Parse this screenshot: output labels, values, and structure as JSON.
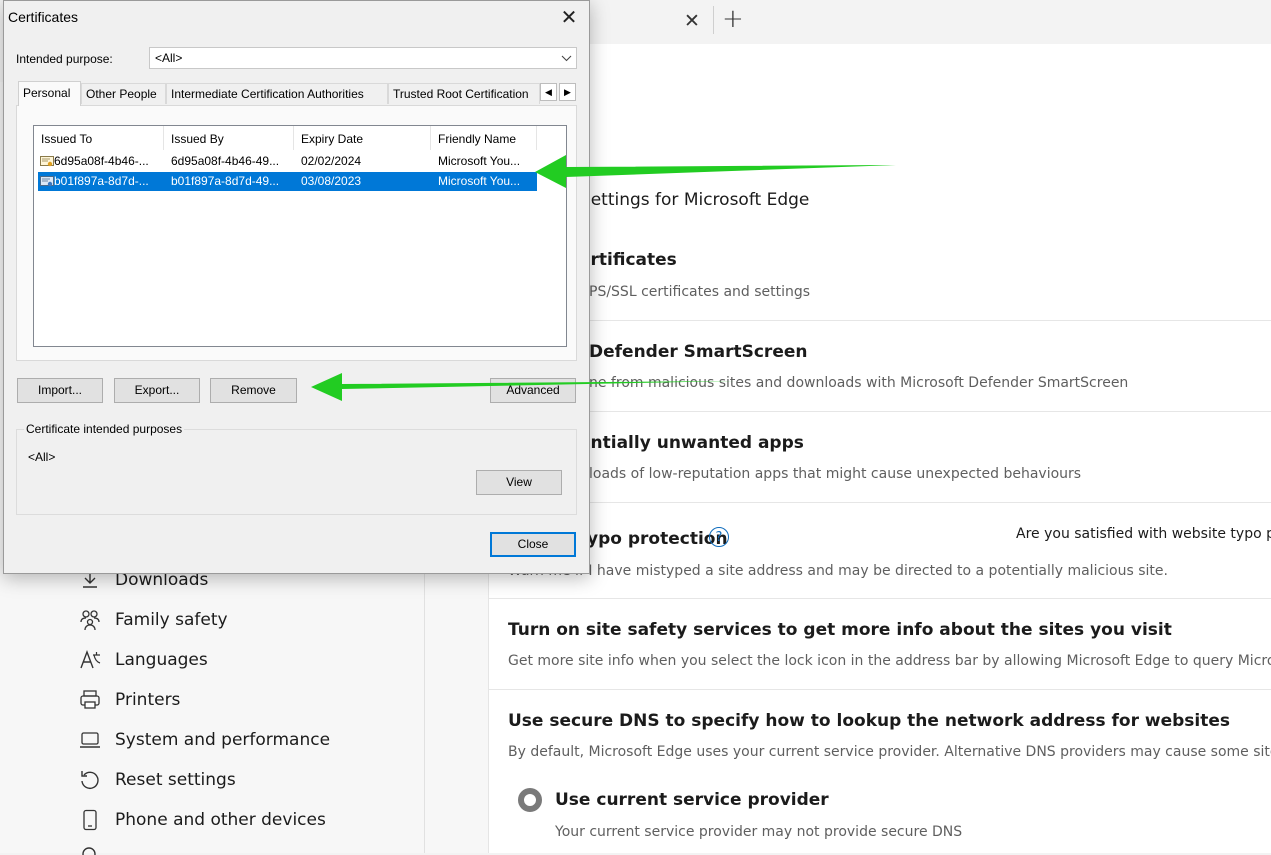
{
  "browser": {
    "tab_close_symbol": "✕",
    "new_tab_symbol": "+"
  },
  "sidebar": {
    "items": [
      {
        "label": "Downloads",
        "icon": "download-icon"
      },
      {
        "label": "Family safety",
        "icon": "family-icon"
      },
      {
        "label": "Languages",
        "icon": "languages-icon"
      },
      {
        "label": "Printers",
        "icon": "printer-icon"
      },
      {
        "label": "System and performance",
        "icon": "laptop-icon"
      },
      {
        "label": "Reset settings",
        "icon": "reset-icon"
      },
      {
        "label": "Phone and other devices",
        "icon": "phone-icon"
      }
    ]
  },
  "settings": {
    "section_title": "rity settings for Microsoft Edge",
    "rows": [
      {
        "title": "ertificates",
        "desc": "PS/SSL certificates and settings"
      },
      {
        "title": "Defender SmartScreen",
        "desc_a": "ne from malicious si",
        "desc_b": "tes and downloads with Microsoft Defender SmartScreen"
      },
      {
        "title": "entially unwanted apps",
        "desc": "loads of low-reputation apps that might cause unexpected behaviours"
      },
      {
        "title": "ypo protection",
        "desc": "Warn me if I have mistyped a site address and may be directed to a potentially malicious site.",
        "help": "?",
        "feedback": "Are you satisfied with website typo pro"
      },
      {
        "title": "Turn on site safety services to get more info about the sites you visit",
        "desc": "Get more site info when you select the lock icon in the address bar by allowing Microsoft Edge to query Microsoft B"
      },
      {
        "title": "Use secure DNS to specify how to lookup the network address for websites",
        "desc": "By default, Microsoft Edge uses your current service provider. Alternative DNS providers may cause some sites to no"
      }
    ],
    "dns_option": {
      "label": "Use current service provider",
      "desc": "Your current service provider may not provide secure DNS"
    }
  },
  "dialog": {
    "title": "Certificates",
    "close_symbol": "✕",
    "purpose_label": "Intended purpose:",
    "purpose_value": "<All>",
    "tabs": [
      "Personal",
      "Other People",
      "Intermediate Certification Authorities",
      "Trusted Root Certification"
    ],
    "tab_scroll_left": "◀",
    "tab_scroll_right": "▶",
    "columns": [
      "Issued To",
      "Issued By",
      "Expiry Date",
      "Friendly Name"
    ],
    "rows": [
      {
        "issued_to": "6d95a08f-4b46-...",
        "issued_by": "6d95a08f-4b46-49...",
        "expiry": "02/02/2024",
        "friendly": "Microsoft You...",
        "selected": false
      },
      {
        "issued_to": "b01f897a-8d7d-...",
        "issued_by": "b01f897a-8d7d-49...",
        "expiry": "03/08/2023",
        "friendly": "Microsoft You...",
        "selected": true
      }
    ],
    "buttons": {
      "import": "Import...",
      "export": "Export...",
      "remove": "Remove",
      "advanced": "Advanced",
      "view": "View",
      "close": "Close"
    },
    "purposes_group_label": "Certificate intended purposes",
    "purposes_value": "<All>"
  },
  "colors": {
    "selection": "#0078d7",
    "arrow": "#22cc22",
    "link_blue": "#0f6cbd"
  }
}
